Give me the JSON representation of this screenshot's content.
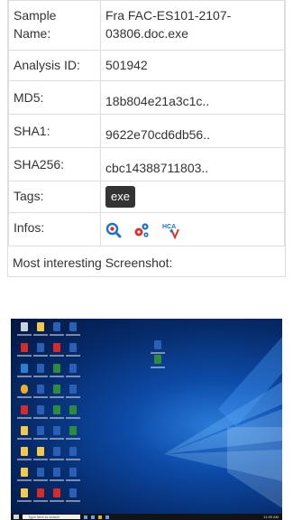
{
  "rows": {
    "sample_name": {
      "label": "Sample Name:",
      "value": "Fra FAC-ES101-2107-03806.doc.exe"
    },
    "analysis_id": {
      "label": "Analysis ID:",
      "value": "501942"
    },
    "md5": {
      "label": "MD5:",
      "value": "18b804e21a3c1c.."
    },
    "sha1": {
      "label": "SHA1:",
      "value": "9622e70cd6db56.."
    },
    "sha256": {
      "label": "SHA256:",
      "value": "cbc14388711803.."
    },
    "tags": {
      "label": "Tags:",
      "items": [
        "exe"
      ]
    },
    "infos": {
      "label": "Infos:",
      "icons": [
        "magnifier-icon",
        "gears-icon",
        "hca-icon"
      ]
    }
  },
  "screenshot": {
    "title": "Most interesting Screenshot:",
    "search_placeholder": "Type here to search",
    "tray_time": "11:09 AM",
    "colors": {
      "accent": "#0d4ba8",
      "tag_bg": "#333333",
      "icon_red": "#e0302a",
      "icon_blue": "#1e73c8"
    }
  }
}
